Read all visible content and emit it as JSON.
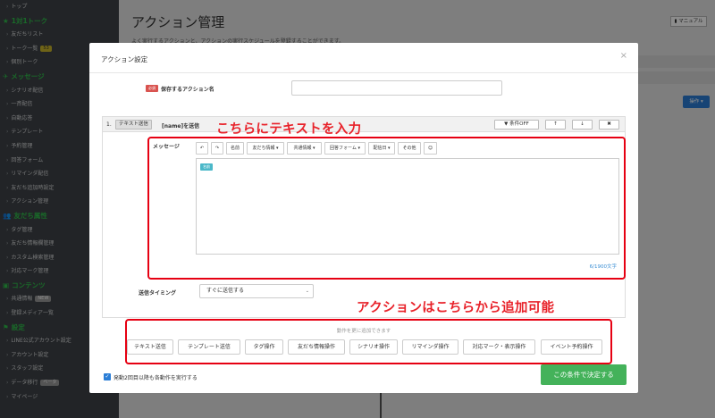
{
  "sidebar": {
    "items": [
      {
        "kind": "item",
        "label": "トップ"
      },
      {
        "kind": "section",
        "label": "1対1トーク",
        "icon": "star-icon"
      },
      {
        "kind": "item",
        "label": "友だちリスト"
      },
      {
        "kind": "item",
        "label": "トーク一覧",
        "badge": "53"
      },
      {
        "kind": "item",
        "label": "個別トーク"
      },
      {
        "kind": "section",
        "label": "メッセージ",
        "icon": "paper-plane-icon"
      },
      {
        "kind": "item",
        "label": "シナリオ配信"
      },
      {
        "kind": "item",
        "label": "一斉配信"
      },
      {
        "kind": "item",
        "label": "自動応答"
      },
      {
        "kind": "item",
        "label": "テンプレート"
      },
      {
        "kind": "item",
        "label": "予約管理"
      },
      {
        "kind": "item",
        "label": "回答フォーム"
      },
      {
        "kind": "item",
        "label": "リマインダ配信"
      },
      {
        "kind": "item",
        "label": "友だち追加時設定"
      },
      {
        "kind": "item",
        "label": "アクション管理"
      },
      {
        "kind": "section",
        "label": "友だち属性",
        "icon": "users-icon"
      },
      {
        "kind": "item",
        "label": "タグ管理"
      },
      {
        "kind": "item",
        "label": "友だち情報欄管理"
      },
      {
        "kind": "item",
        "label": "カスタム検索管理"
      },
      {
        "kind": "item",
        "label": "対応マーク管理"
      },
      {
        "kind": "section",
        "label": "コンテンツ",
        "icon": "folder-icon"
      },
      {
        "kind": "item",
        "label": "共通情報",
        "badge": "NEW",
        "badge_style": "grey"
      },
      {
        "kind": "item",
        "label": "登録メディア一覧"
      },
      {
        "kind": "section",
        "label": "設定",
        "icon": "flag-icon"
      },
      {
        "kind": "item",
        "label": "LINE公式アカウント設定"
      },
      {
        "kind": "item",
        "label": "アカウント設定"
      },
      {
        "kind": "item",
        "label": "スタッフ設定"
      },
      {
        "kind": "item",
        "label": "データ移行",
        "badge": "ベータ",
        "badge_style": "grey"
      },
      {
        "kind": "item",
        "label": "マイページ"
      }
    ]
  },
  "main": {
    "title": "アクション管理",
    "description": "よく実行するアクションと、アクションの実行スケジュールを登録することができます。",
    "manual_button": "マニュアル",
    "operation_button": "操作 ▾"
  },
  "modal": {
    "title": "アクション設定",
    "close": "×",
    "required_badge": "必須",
    "name_label": "保存するアクション名",
    "name_value": "",
    "action": {
      "number": "1.",
      "type_chip": "テキスト送信",
      "name": "[name]を送信",
      "condition_button": "条件OFF",
      "up": "↑",
      "down": "↓",
      "delete": "✖",
      "message_label": "メッセージ",
      "toolbar": [
        {
          "label": "↶",
          "name": "undo-button"
        },
        {
          "label": "↷",
          "name": "redo-button"
        },
        {
          "label": "名前",
          "name": "insert-name-button"
        },
        {
          "label": "友だち情報 ▾",
          "name": "friend-info-dropdown"
        },
        {
          "label": "共通情報 ▾",
          "name": "common-info-dropdown"
        },
        {
          "label": "回答フォーム ▾",
          "name": "answer-form-dropdown"
        },
        {
          "label": "配信日 ▾",
          "name": "delivery-date-dropdown"
        },
        {
          "label": "その他",
          "name": "other-button"
        },
        {
          "label": "☺",
          "name": "emoji-button"
        }
      ],
      "name_chip": "名前",
      "char_count": "6/1900文字",
      "timing_label": "送信タイミング",
      "timing_value": "すぐに送信する"
    },
    "add_hint": "動作を更に追加できます",
    "add_buttons": [
      "テキスト送信",
      "テンプレート送信",
      "タグ操作",
      "友だち情報操作",
      "シナリオ操作",
      "リマインダ操作",
      "対応マーク・表示操作",
      "イベント予約操作"
    ],
    "repeat_label": "発動2回目以降も各動作を実行する",
    "repeat_checked": true,
    "submit_button": "この条件で決定する"
  },
  "annotations": {
    "text_input": "こちらにテキストを入力",
    "add_actions": "アクションはこちらから追加可能"
  },
  "colors": {
    "sidebar_bg": "#3f4347",
    "sidebar_section": "#2fbf4a",
    "annotation_red": "#e60012",
    "submit_green": "#44b25a",
    "primary_blue": "#2a7dd6"
  }
}
